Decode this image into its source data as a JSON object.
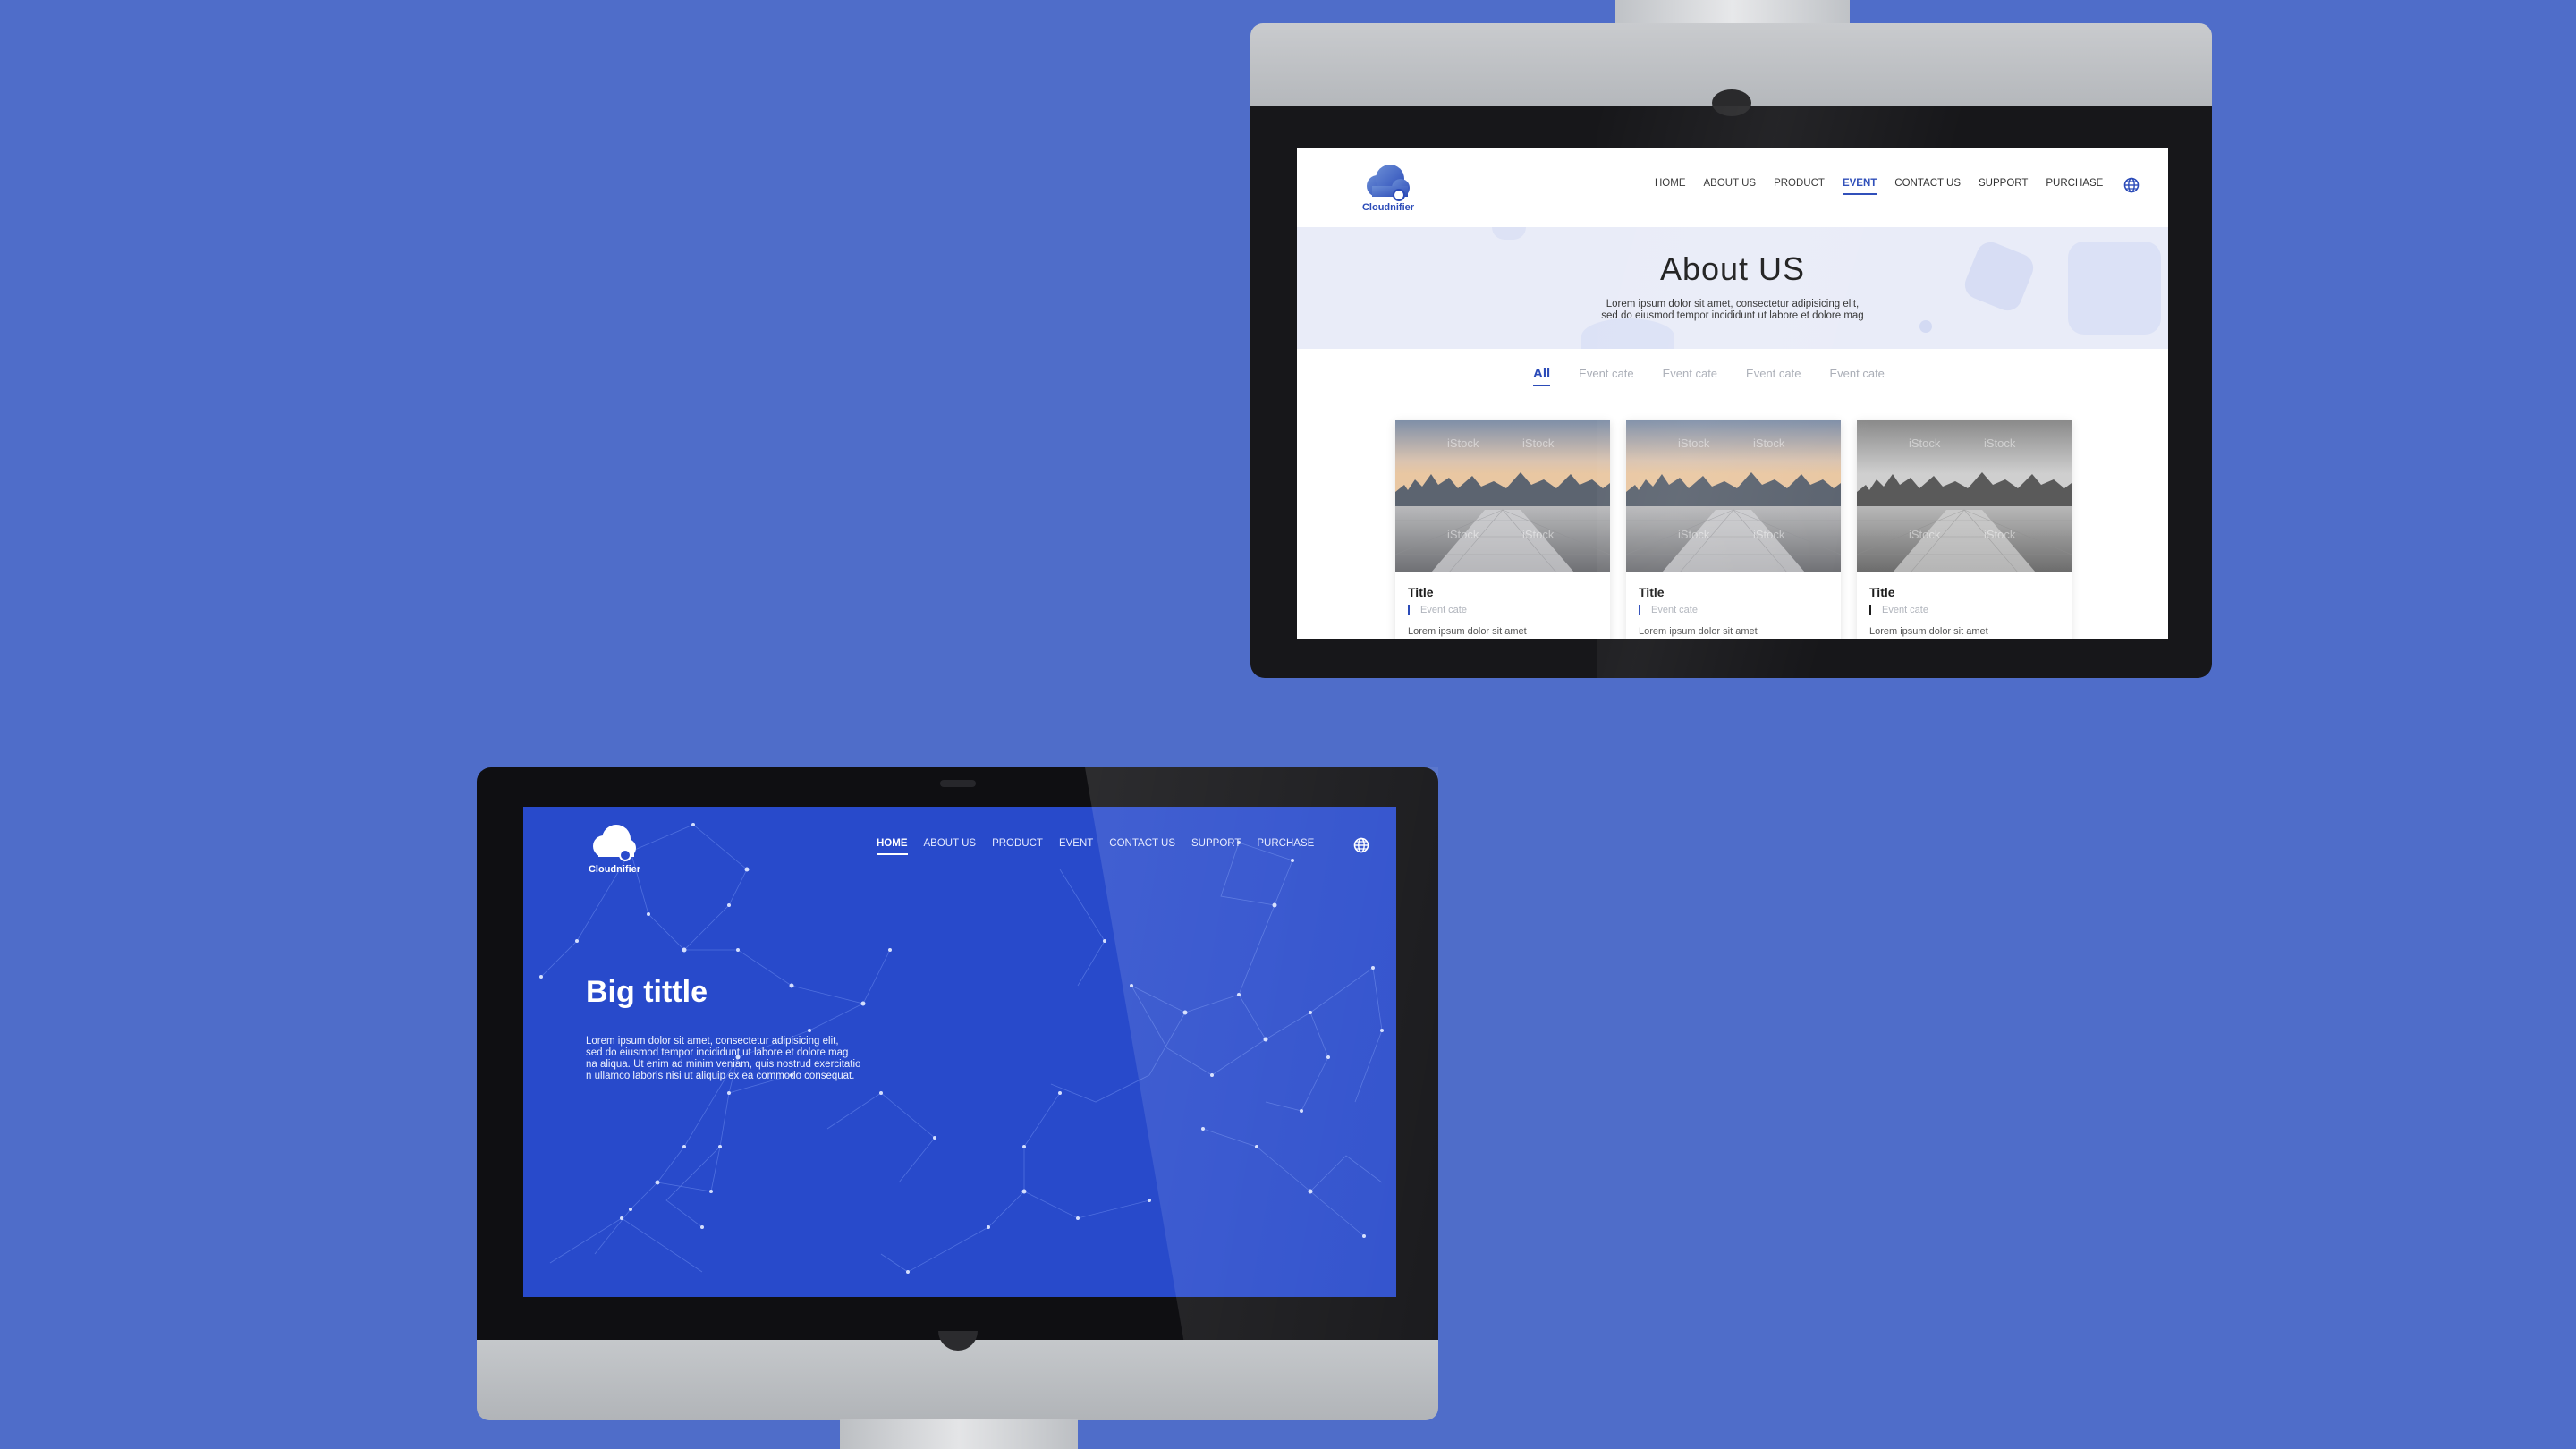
{
  "colors": {
    "background": "#4F6DC9",
    "brand_blue": "#2B4BB8",
    "hero_blue": "#284ACB"
  },
  "top_site": {
    "logo_text": "Cloudnifier",
    "nav": [
      {
        "label": "HOME"
      },
      {
        "label": "ABOUT US"
      },
      {
        "label": "PRODUCT"
      },
      {
        "label": "EVENT"
      },
      {
        "label": "CONTACT US"
      },
      {
        "label": "SUPPORT"
      },
      {
        "label": "PURCHASE"
      }
    ],
    "active_nav": "EVENT",
    "hero": {
      "title": "About US",
      "desc_line1": "Lorem ipsum dolor sit amet, consectetur adipisicing elit,",
      "desc_line2": "sed do eiusmod tempor incididunt ut labore et dolore mag"
    },
    "tabs": [
      "All",
      "Event cate",
      "Event cate",
      "Event cate",
      "Event cate"
    ],
    "cards": [
      {
        "title": "Title",
        "cate": "Event cate",
        "text": "Lorem ipsum dolor sit amet",
        "watermark": "iStock"
      },
      {
        "title": "Title",
        "cate": "Event cate",
        "text": "Lorem ipsum dolor sit amet",
        "watermark": "iStock"
      },
      {
        "title": "Title",
        "cate": "Event cate",
        "text": "Lorem ipsum dolor sit amet",
        "watermark": "iStock"
      }
    ]
  },
  "bottom_site": {
    "logo_text": "Cloudnifier",
    "nav": [
      {
        "label": "HOME"
      },
      {
        "label": "ABOUT US"
      },
      {
        "label": "PRODUCT"
      },
      {
        "label": "EVENT"
      },
      {
        "label": "CONTACT US"
      },
      {
        "label": "SUPPORT"
      },
      {
        "label": "PURCHASE"
      }
    ],
    "active_nav": "HOME",
    "title": "Big tittle",
    "desc": [
      "Lorem ipsum dolor sit amet, consectetur adipisicing elit,",
      "sed do eiusmod tempor incididunt ut labore et dolore mag",
      "na aliqua. Ut enim ad minim veniam, quis nostrud exercitatio",
      "n ullamco laboris nisi ut aliquip ex ea commodo consequat."
    ]
  },
  "icons": {
    "globe": "globe-icon",
    "logo": "cloud-logo-icon"
  }
}
